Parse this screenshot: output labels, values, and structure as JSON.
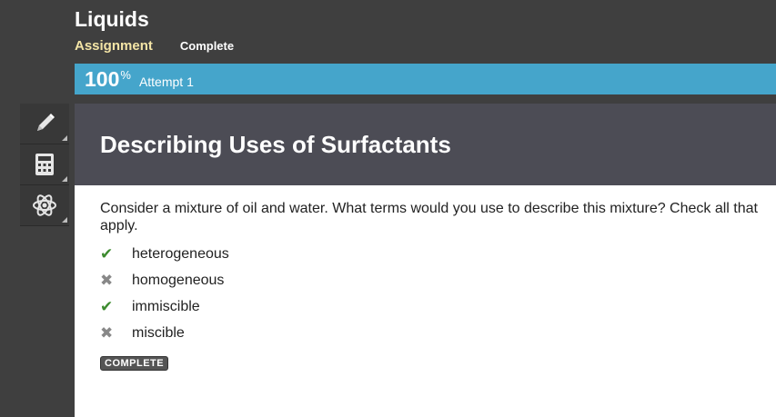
{
  "header": {
    "title": "Liquids",
    "assignment_label": "Assignment",
    "status": "Complete"
  },
  "progress": {
    "percent": 100,
    "percent_number": "100",
    "percent_sign": "%",
    "attempt": "Attempt 1",
    "color": "#45a5cb"
  },
  "tools": [
    {
      "icon": "pencil-icon",
      "glyph": "✎"
    },
    {
      "icon": "calculator-icon",
      "glyph": "▦"
    },
    {
      "icon": "atom-icon",
      "glyph": "⚛"
    }
  ],
  "question": {
    "title": "Describing Uses of Surfactants",
    "prompt": "Consider a mixture of oil and water. What terms would you use to describe this mixture? Check all that apply.",
    "options": [
      {
        "label": "heterogeneous",
        "mark": "✔",
        "correct": true
      },
      {
        "label": "homogeneous",
        "mark": "✖",
        "correct": false
      },
      {
        "label": "immiscible",
        "mark": "✔",
        "correct": true
      },
      {
        "label": "miscible",
        "mark": "✖",
        "correct": false
      }
    ],
    "status_badge": "COMPLETE"
  },
  "colors": {
    "check": "#3d8b2f",
    "cross": "#888888",
    "assignment_label": "#f4e5a6"
  }
}
